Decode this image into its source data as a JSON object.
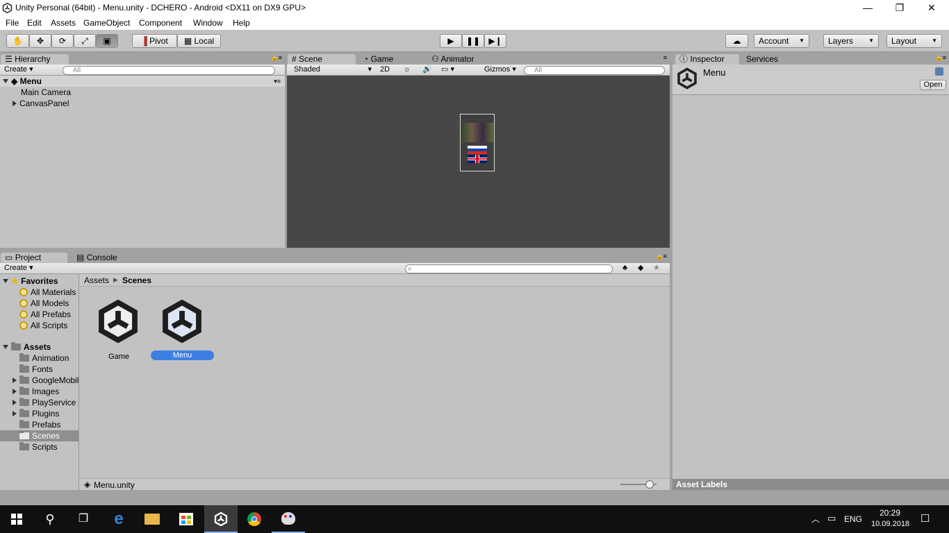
{
  "window": {
    "title": "Unity Personal (64bit) - Menu.unity - DCHERO - Android <DX11 on DX9 GPU>",
    "minimize": "—",
    "maximize": "❐",
    "close": "✕"
  },
  "menu": [
    "File",
    "Edit",
    "Assets",
    "GameObject",
    "Component",
    "Window",
    "Help"
  ],
  "toolbar": {
    "pivot": "Pivot",
    "local": "Local",
    "account": "Account",
    "layers": "Layers",
    "layout": "Layout"
  },
  "hierarchy": {
    "tab": "Hierarchy",
    "create": "Create",
    "search": "All",
    "scene": "Menu",
    "items": [
      "Main Camera",
      "CanvasPanel"
    ]
  },
  "scene_view": {
    "tabs": [
      "Scene",
      "Game",
      "Animator"
    ],
    "shading": "Shaded",
    "mode2d": "2D",
    "gizmos": "Gizmos",
    "search": "All"
  },
  "inspector": {
    "tabs": [
      "Inspector",
      "Services"
    ],
    "object": "Menu",
    "open": "Open",
    "footer": "Asset Labels"
  },
  "project": {
    "tabs": [
      "Project",
      "Console"
    ],
    "create": "Create",
    "breadcrumb": [
      "Assets",
      "Scenes"
    ],
    "favorites_label": "Favorites",
    "favorites": [
      "All Materials",
      "All Models",
      "All Prefabs",
      "All Scripts"
    ],
    "assets_label": "Assets",
    "folders": [
      "Animation",
      "Fonts",
      "GoogleMobil",
      "Images",
      "PlayService",
      "Plugins",
      "Prefabs",
      "Scenes",
      "Scripts"
    ],
    "files": [
      "Game",
      "Menu"
    ],
    "status": "Menu.unity"
  },
  "taskbar": {
    "lang": "ENG",
    "time": "20:29",
    "date": "10.09.2018"
  },
  "colors": {
    "accent": "#3d7ee3",
    "scene_bg": "#474747",
    "panel": "#c2c2c2",
    "taskbar": "#101010"
  }
}
